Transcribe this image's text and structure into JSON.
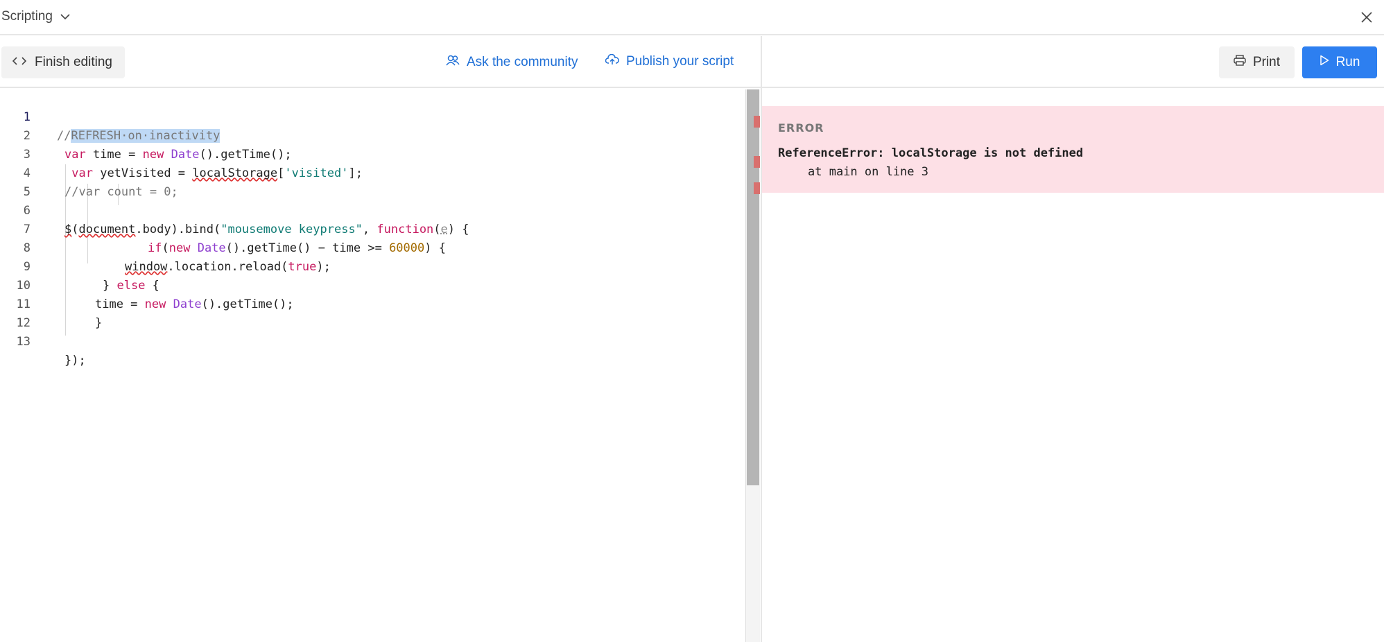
{
  "titlebar": {
    "title": "Scripting"
  },
  "toolbar": {
    "finish_label": "Finish editing",
    "community_label": "Ask the community",
    "publish_label": "Publish your script",
    "print_label": "Print",
    "run_label": "Run"
  },
  "editor": {
    "line_numbers": [
      "1",
      "2",
      "3",
      "4",
      "5",
      "6",
      "7",
      "8",
      "9",
      "10",
      "11",
      "12",
      "13"
    ],
    "lines": [
      "//REFRESH on inactivity",
      "var time = new Date().getTime();",
      " var yetVisited = localStorage['visited'];",
      "//var count = 0;",
      "",
      "$(document.body).bind(\"mousemove keypress\", function(e) {",
      "if(new Date().getTime() - time >= 60000) {",
      "window.location.reload(true);",
      "} else {",
      "time = new Date().getTime();",
      "}",
      "",
      "});"
    ]
  },
  "error": {
    "heading": "ERROR",
    "message": "ReferenceError: localStorage is not defined",
    "location": "at main on line 3"
  },
  "colors": {
    "accent": "#2d7ff0",
    "link": "#1f6fd6",
    "error_bg": "#fde0e6",
    "error_marker": "#d9706e"
  },
  "icons": [
    "chevron-down-icon",
    "close-icon",
    "code-icon",
    "community-icon",
    "cloud-upload-icon",
    "printer-icon",
    "play-icon"
  ]
}
